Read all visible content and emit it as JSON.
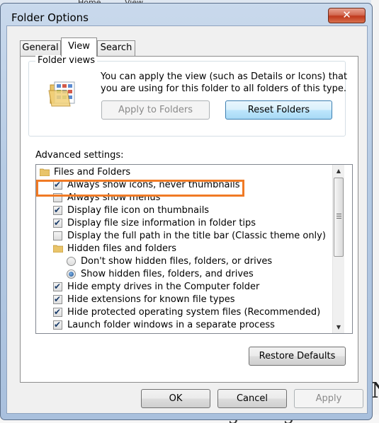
{
  "background": {
    "ribbon_tabs": [
      "Home",
      "View"
    ],
    "doc_text": "was getting that if",
    "doc_cap": "N"
  },
  "dialog": {
    "title": "Folder Options",
    "close_glyph": "✕",
    "tabs": [
      {
        "label": "General",
        "active": false
      },
      {
        "label": "View",
        "active": true
      },
      {
        "label": "Search",
        "active": false
      }
    ],
    "folder_views": {
      "title": "Folder views",
      "description": "You can apply the view (such as Details or Icons) that you are using for this folder to all folders of this type.",
      "apply_button": "Apply to Folders",
      "reset_button": "Reset Folders"
    },
    "advanced": {
      "label": "Advanced settings:",
      "items": [
        {
          "type": "folder",
          "label": "Files and Folders",
          "checked": null
        },
        {
          "type": "checkbox",
          "label": "Always show icons, never thumbnails",
          "checked": true
        },
        {
          "type": "checkbox",
          "label": "Always show menus",
          "checked": false
        },
        {
          "type": "checkbox",
          "label": "Display file icon on thumbnails",
          "checked": true
        },
        {
          "type": "checkbox",
          "label": "Display file size information in folder tips",
          "checked": true
        },
        {
          "type": "checkbox",
          "label": "Display the full path in the title bar (Classic theme only)",
          "checked": false
        },
        {
          "type": "folder",
          "label": "Hidden files and folders",
          "checked": null
        },
        {
          "type": "radio",
          "label": "Don't show hidden files, folders, or drives",
          "checked": false
        },
        {
          "type": "radio",
          "label": "Show hidden files, folders, and drives",
          "checked": true
        },
        {
          "type": "checkbox",
          "label": "Hide empty drives in the Computer folder",
          "checked": true
        },
        {
          "type": "checkbox",
          "label": "Hide extensions for known file types",
          "checked": true
        },
        {
          "type": "checkbox",
          "label": "Hide protected operating system files (Recommended)",
          "checked": true
        },
        {
          "type": "checkbox",
          "label": "Launch folder windows in a separate process",
          "checked": true
        }
      ],
      "restore_button": "Restore Defaults"
    },
    "footer": {
      "ok": "OK",
      "cancel": "Cancel",
      "apply": "Apply"
    },
    "highlight_color": "#f07a25"
  }
}
